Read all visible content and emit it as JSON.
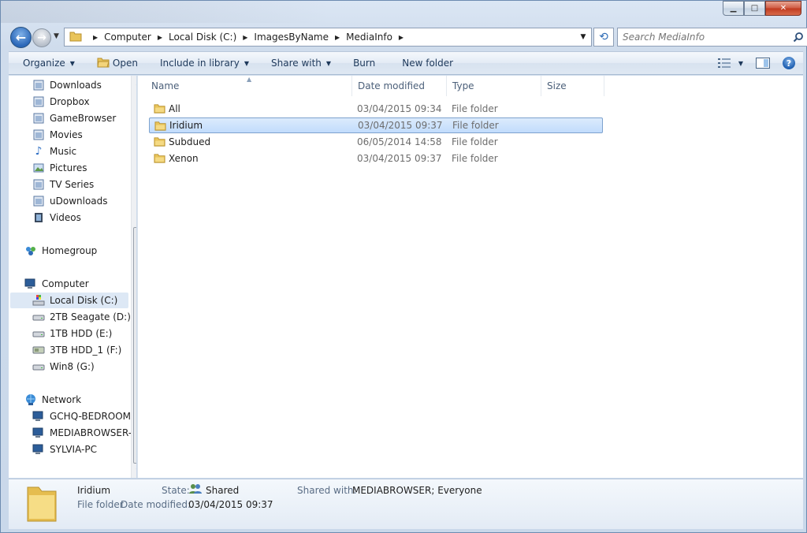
{
  "window": {
    "minimize_glyph": "▁",
    "maximize_glyph": "□",
    "close_glyph": "✕"
  },
  "address_bar": {
    "crumbs": [
      "Computer",
      "Local Disk (C:)",
      "ImagesByName",
      "MediaInfo"
    ],
    "separator_glyph": "▶"
  },
  "search": {
    "placeholder": "Search MediaInfo"
  },
  "toolbar": {
    "organize": "Organize",
    "open": "Open",
    "include_in_library": "Include in library",
    "share_with": "Share with",
    "burn": "Burn",
    "new_folder": "New folder",
    "help_glyph": "?"
  },
  "nav_pane": {
    "favorites": [
      {
        "label": "Downloads",
        "icon": "library-icon"
      },
      {
        "label": "Dropbox",
        "icon": "library-icon"
      },
      {
        "label": "GameBrowser",
        "icon": "library-icon"
      },
      {
        "label": "Movies",
        "icon": "library-icon"
      },
      {
        "label": "Music",
        "icon": "music-icon"
      },
      {
        "label": "Pictures",
        "icon": "pictures-icon"
      },
      {
        "label": "TV Series",
        "icon": "library-icon"
      },
      {
        "label": "uDownloads",
        "icon": "library-icon"
      },
      {
        "label": "Videos",
        "icon": "videos-icon"
      }
    ],
    "homegroup": "Homegroup",
    "computer": "Computer",
    "drives": [
      {
        "label": "Local Disk (C:)",
        "selected": true
      },
      {
        "label": "2TB Seagate (D:)"
      },
      {
        "label": "1TB HDD (E:)"
      },
      {
        "label": "3TB HDD_1 (F:)"
      },
      {
        "label": "Win8 (G:)"
      }
    ],
    "network": "Network",
    "network_items": [
      "GCHQ-BEDROOM",
      "MEDIABROWSER-",
      "SYLVIA-PC"
    ]
  },
  "columns": {
    "name": "Name",
    "date_modified": "Date modified",
    "type": "Type",
    "size": "Size"
  },
  "files": [
    {
      "name": "All",
      "date": "03/04/2015 09:34",
      "type": "File folder"
    },
    {
      "name": "Iridium",
      "date": "03/04/2015 09:37",
      "type": "File folder",
      "selected": true
    },
    {
      "name": "Subdued",
      "date": "06/05/2014 14:58",
      "type": "File folder"
    },
    {
      "name": "Xenon",
      "date": "03/04/2015 09:37",
      "type": "File folder"
    }
  ],
  "details": {
    "name": "Iridium",
    "kind": "File folder",
    "state_label": "State:",
    "state_value": "Shared",
    "date_label": "Date modified:",
    "date_value": "03/04/2015 09:37",
    "shared_with_label": "Shared with:",
    "shared_with_value": "MEDIABROWSER; Everyone"
  }
}
